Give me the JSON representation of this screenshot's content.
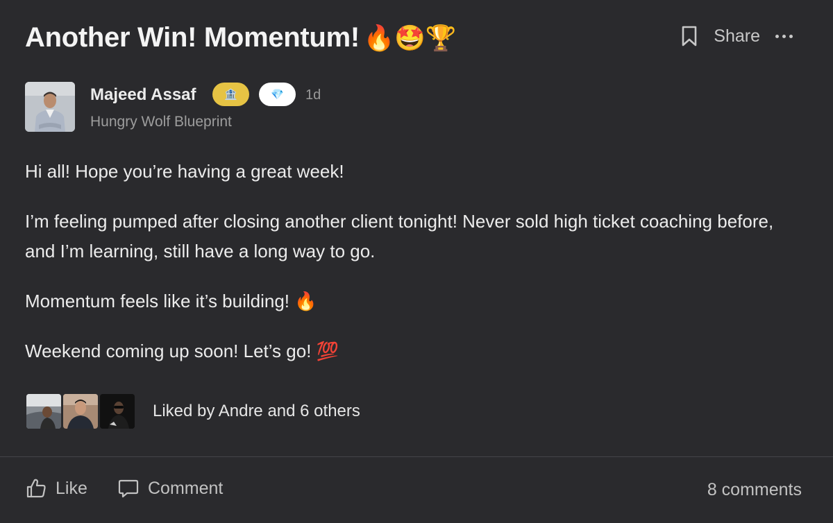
{
  "post": {
    "title": "Another Win! Momentum!",
    "title_emoji": "🔥🤩🏆",
    "share_label": "Share",
    "author": {
      "name": "Majeed Assaf",
      "badge_gold_icon": "🏦",
      "badge_white_icon": "💎",
      "time": "1d",
      "group": "Hungry Wolf Blueprint"
    },
    "paragraphs": [
      "Hi all! Hope you’re having a great week!",
      "I’m feeling pumped after closing another client tonight! Never sold high ticket coaching before, and I’m learning, still have a long way to go.",
      "Momentum feels like it’s building! 🔥",
      "Weekend coming up soon! Let’s go! 💯"
    ],
    "likes_text": "Liked by Andre and 6 others",
    "footer": {
      "like_label": "Like",
      "comment_label": "Comment",
      "comments_count": "8 comments"
    }
  },
  "icons": {
    "bookmark": "bookmark-icon",
    "more": "more-icon",
    "like": "thumbs-up-icon",
    "comment": "comment-bubble-icon"
  },
  "colors": {
    "background": "#2a2a2d",
    "gold_badge": "#e6c344",
    "text": "#ececec",
    "muted": "#9d9d9d"
  }
}
